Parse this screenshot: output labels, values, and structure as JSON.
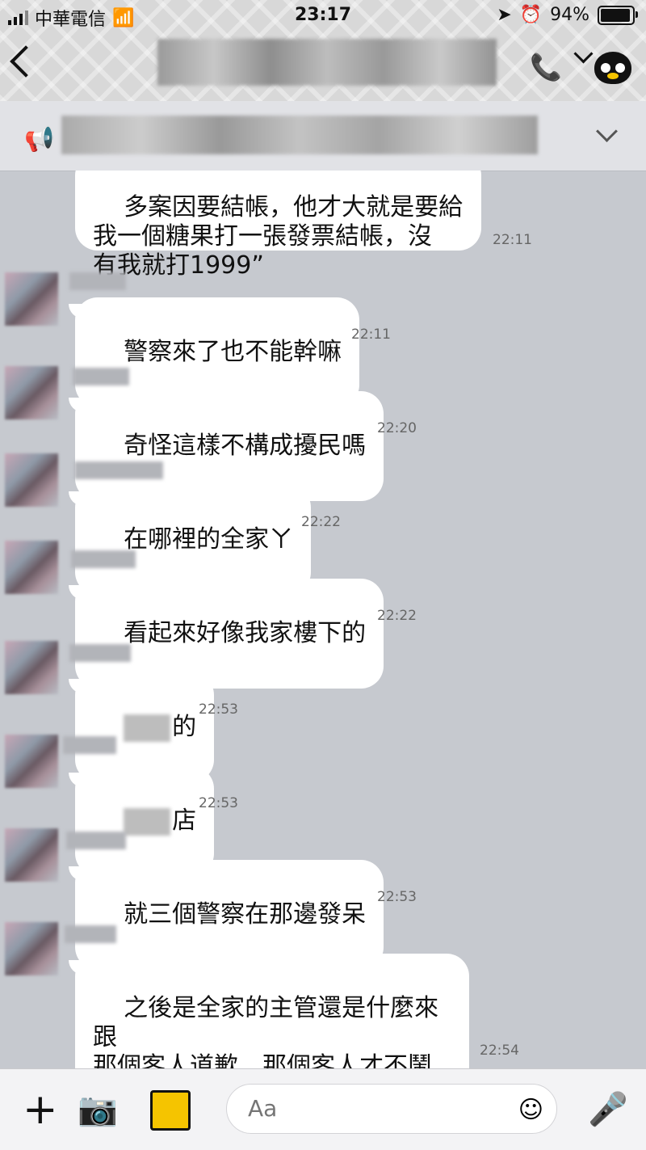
{
  "status": {
    "carrier": "中華電信",
    "time": "23:17",
    "battery": "94%",
    "battery_level": 0.94
  },
  "header": {
    "back_icon": "chevron-left-icon",
    "call_icon": "phone-icon",
    "menu_icon": "chevron-down-icon"
  },
  "announcement": {
    "icon": "megaphone-icon",
    "expand_icon": "chevron-down-icon"
  },
  "messages": [
    {
      "text": "多案因要結帳，他才大就是要給\n我一個糖果打一張發票結帳，沒\n有我就打1999”",
      "time": "22:11"
    },
    {
      "text": "警察來了也不能幹嘛",
      "time": "22:11"
    },
    {
      "text": "奇怪這樣不構成擾民嗎",
      "time": "22:20"
    },
    {
      "text": "在哪裡的全家ㄚ",
      "time": "22:22"
    },
    {
      "text": "看起來好像我家樓下的",
      "time": "22:22"
    },
    {
      "text": "的",
      "time": "22:53"
    },
    {
      "text": "店",
      "time": "22:53"
    },
    {
      "text": "就三個警察在那邊發呆",
      "time": "22:53"
    },
    {
      "text": "之後是全家的主管還是什麼來跟\n那個客人道歉　那個客人才不鬧\n事",
      "time": "22:54"
    }
  ],
  "input": {
    "placeholder": "Aa"
  }
}
